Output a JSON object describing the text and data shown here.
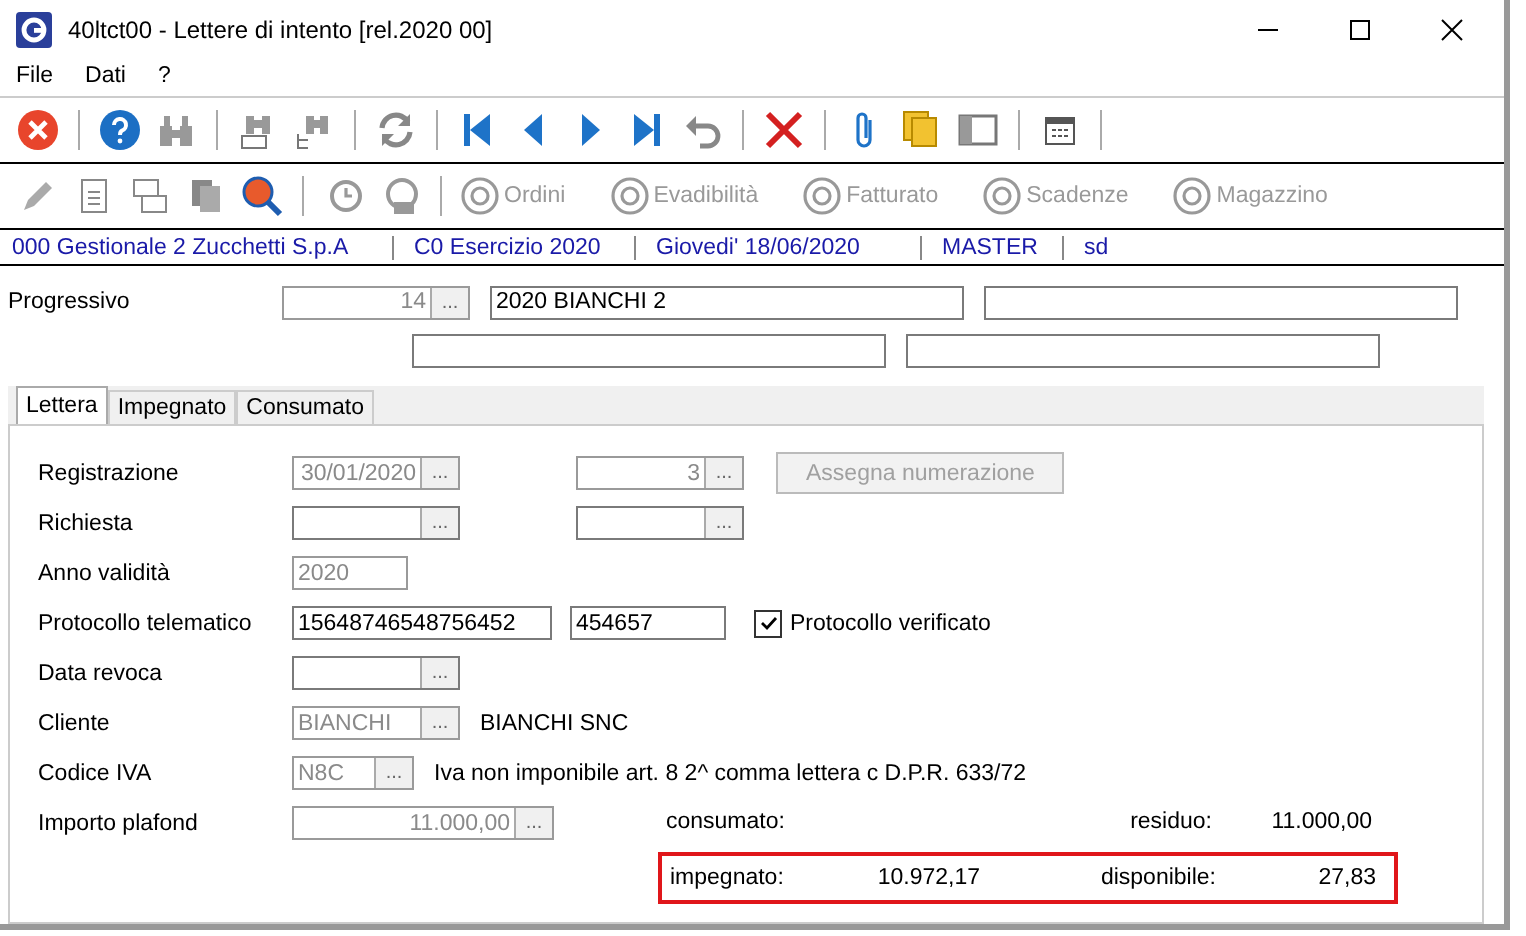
{
  "window": {
    "title": "40ltct00 - Lettere di intento  [rel.2020 00]"
  },
  "menu": [
    "File",
    "Dati",
    "?"
  ],
  "toolbar2_buttons": [
    {
      "label": "Ordini",
      "disabled": true
    },
    {
      "label": "Evadibilità",
      "disabled": true
    },
    {
      "label": "Fatturato",
      "disabled": true
    },
    {
      "label": "Scadenze",
      "disabled": true
    },
    {
      "label": "Magazzino",
      "disabled": true
    }
  ],
  "status_bar": [
    "000 Gestionale 2 Zucchetti S.p.A",
    "C0 Esercizio 2020",
    "Giovedi' 18/06/2020",
    "MASTER",
    "sd"
  ],
  "header": {
    "label": "Progressivo",
    "progressivo": {
      "value": "14",
      "disabled": true,
      "lookup": "..."
    },
    "description": "2020 BIANCHI 2"
  },
  "tabs": [
    {
      "label": "Lettera",
      "selected": true
    },
    {
      "label": "Impegnato",
      "selected": false
    },
    {
      "label": "Consumato",
      "selected": false
    }
  ],
  "registrazione": {
    "label": "Registrazione",
    "date": {
      "value": "30/01/2020",
      "disabled": true,
      "lookup": "..."
    },
    "number": {
      "value": "3",
      "disabled": true,
      "lookup": "..."
    },
    "button": {
      "label": "Assegna numerazione",
      "disabled": true
    }
  },
  "richiesta": {
    "label": "Richiesta",
    "date": {
      "disabled": false,
      "lookup": "..."
    },
    "number": {
      "disabled": false,
      "lookup": "..."
    }
  },
  "anno_validita": {
    "label": "Anno validità",
    "field": {
      "value": "2020",
      "disabled": true
    }
  },
  "protocollo": {
    "label": "Protocollo telematico",
    "field_1": {
      "value": "15648746548756452",
      "disabled": false
    },
    "field_2": {
      "value": "454657",
      "disabled": false
    },
    "verified": {
      "label": "Protocollo verificato",
      "checked": true
    }
  },
  "data_revoca": {
    "label": "Data revoca",
    "field": {
      "disabled": false,
      "lookup": "..."
    }
  },
  "cliente": {
    "label": "Cliente",
    "field": {
      "value": "BIANCHI",
      "disabled": true,
      "lookup": "..."
    },
    "description": "BIANCHI SNC"
  },
  "codice_iva": {
    "label": "Codice IVA",
    "field": {
      "value": "N8C",
      "disabled": true,
      "lookup": "..."
    },
    "description": "Iva non imponibile art. 8 2^ comma lettera c D.P.R. 633/72"
  },
  "importo_plafond": {
    "label": "Importo plafond",
    "field": {
      "value": "11.000,00",
      "disabled": true,
      "lookup": "..."
    }
  },
  "totals": {
    "consumato": {
      "label": "consumato:"
    },
    "residuo": {
      "label": "residuo:",
      "value": "11.000,00"
    },
    "impegnato": {
      "label": "impegnato:",
      "value": "10.972,17"
    },
    "disponibile": {
      "label": "disponibile:",
      "value": "27,83"
    }
  }
}
